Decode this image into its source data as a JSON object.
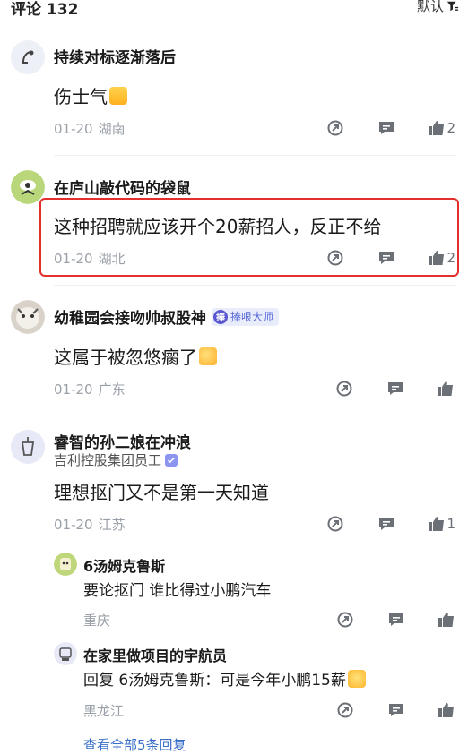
{
  "header": {
    "title": "评论 132",
    "sort_label": "默认"
  },
  "comments": [
    {
      "name": "持续对标逐渐落后",
      "text": "伤士气",
      "date": "01-20",
      "location": "湖南",
      "likes": "2",
      "emoji": "大笑脸"
    },
    {
      "name": "在庐山敲代码的袋鼠",
      "text": "这种招聘就应该开个20薪招人，反正不给",
      "date": "01-20",
      "location": "湖北",
      "likes": "2"
    },
    {
      "name": "幼稚园会接吻帅叔股神",
      "badge": "捧哏大师",
      "badge_icon": "捧",
      "text": "这属于被忽悠瘸了",
      "date": "01-20",
      "location": "广东",
      "likes": ""
    },
    {
      "name": "睿智的孙二娘在冲浪",
      "subtitle": "吉利控股集团员工",
      "text": "理想抠门又不是第一天知道",
      "date": "01-20",
      "location": "江苏",
      "likes": "1",
      "replies": [
        {
          "name": "6汤姆克鲁斯",
          "text": "要论抠门 谁比得过小鹏汽车",
          "location": "重庆"
        },
        {
          "name": "在家里做项目的宇航员",
          "text": "回复 6汤姆克鲁斯：可是今年小鹏15薪",
          "location": "黑龙江"
        }
      ],
      "more_replies": "查看全部5条回复"
    }
  ],
  "colors": {
    "accent": "#3a6fc9",
    "highlight": "#e3302b",
    "meta": "#9aa0a8",
    "icon": "#6b6f76"
  },
  "icons": [
    "filter-icon",
    "share-icon",
    "reply-icon",
    "thumb-up-icon"
  ]
}
